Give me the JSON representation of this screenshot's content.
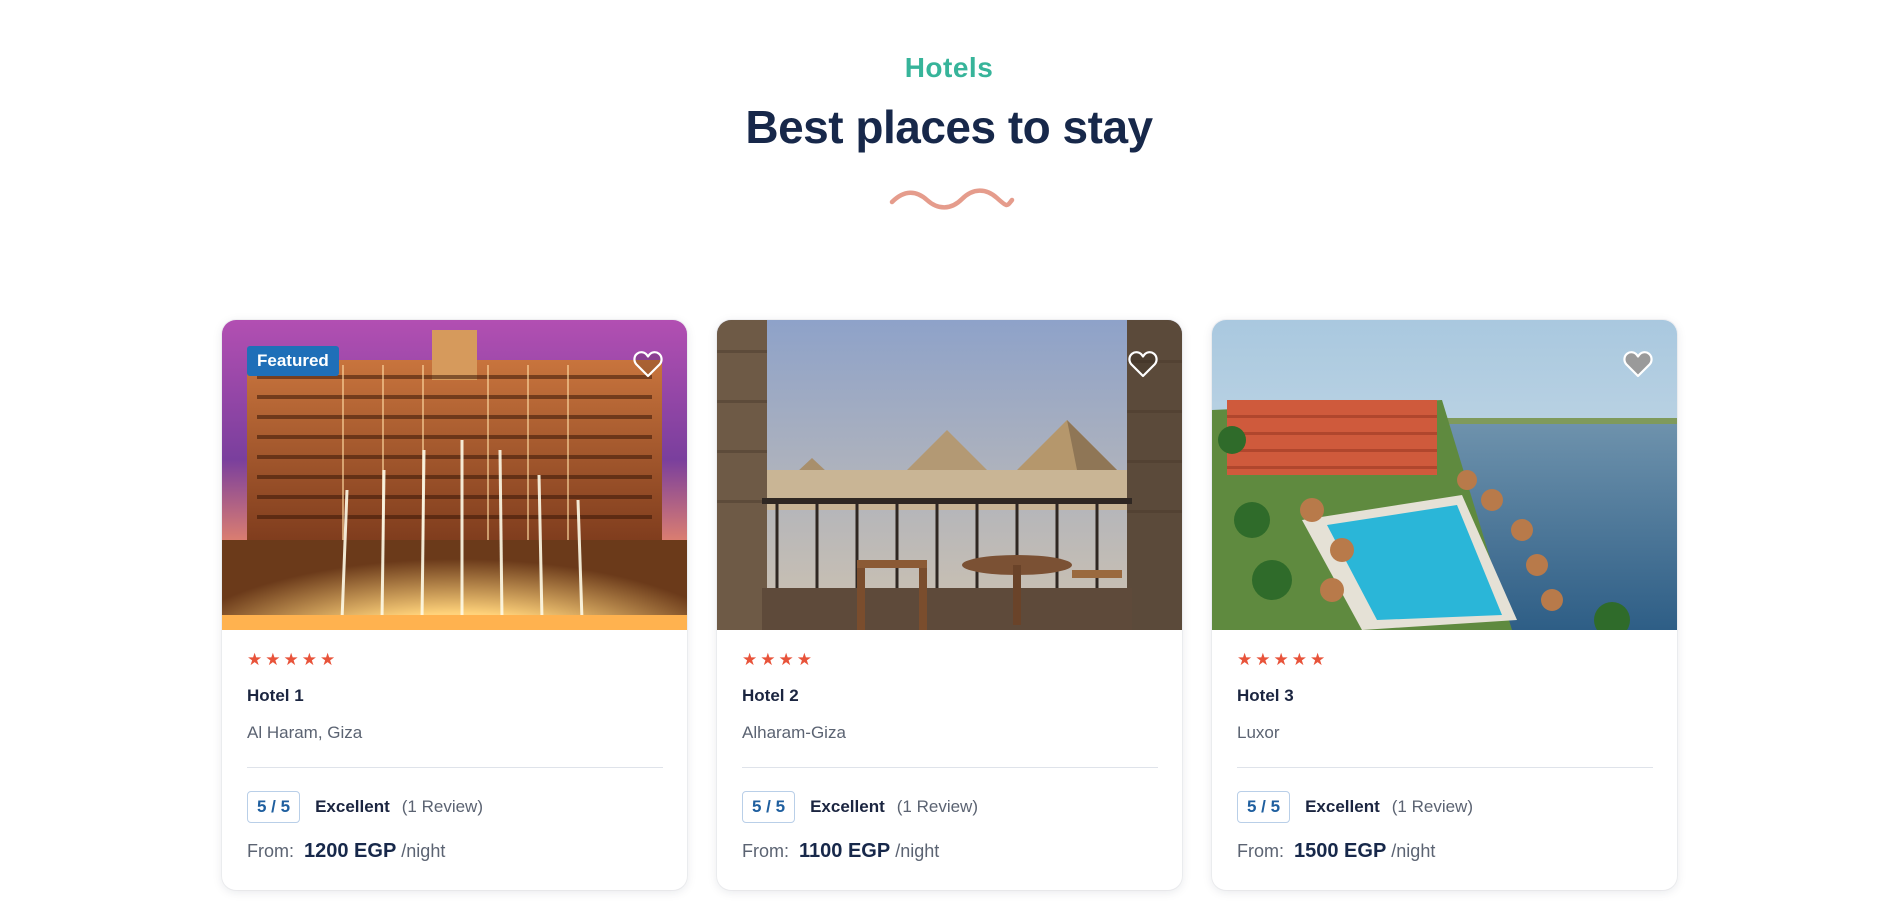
{
  "section": {
    "eyebrow": "Hotels",
    "title": "Best places to stay"
  },
  "colors": {
    "accent_teal": "#37b49a",
    "title_navy": "#17284a",
    "star_red": "#e8533a",
    "squiggle_salmon": "#e59c8c",
    "badge_blue": "#1f6fb8"
  },
  "hotels": [
    {
      "badge": "Featured",
      "stars": "★★★★★",
      "name": "Hotel 1",
      "location": "Al Haram, Giza",
      "score": "5 / 5",
      "verdict": "Excellent",
      "reviews": "(1 Review)",
      "from_label": "From:",
      "price": "1200 EGP",
      "per_night": "/night",
      "photo_icon": "hotel-fountain-photo",
      "heart_icon": "heart-outline-icon"
    },
    {
      "stars": "★★★★",
      "name": "Hotel 2",
      "location": "Alharam-Giza",
      "score": "5 / 5",
      "verdict": "Excellent",
      "reviews": "(1 Review)",
      "from_label": "From:",
      "price": "1100 EGP",
      "per_night": "/night",
      "photo_icon": "pyramids-balcony-photo",
      "heart_icon": "heart-outline-icon"
    },
    {
      "stars": "★★★★★",
      "name": "Hotel 3",
      "location": "Luxor",
      "score": "5 / 5",
      "verdict": "Excellent",
      "reviews": "(1 Review)",
      "from_label": "From:",
      "price": "1500 EGP",
      "per_night": "/night",
      "photo_icon": "nile-resort-pool-photo",
      "heart_icon": "heart-filled-icon"
    }
  ]
}
